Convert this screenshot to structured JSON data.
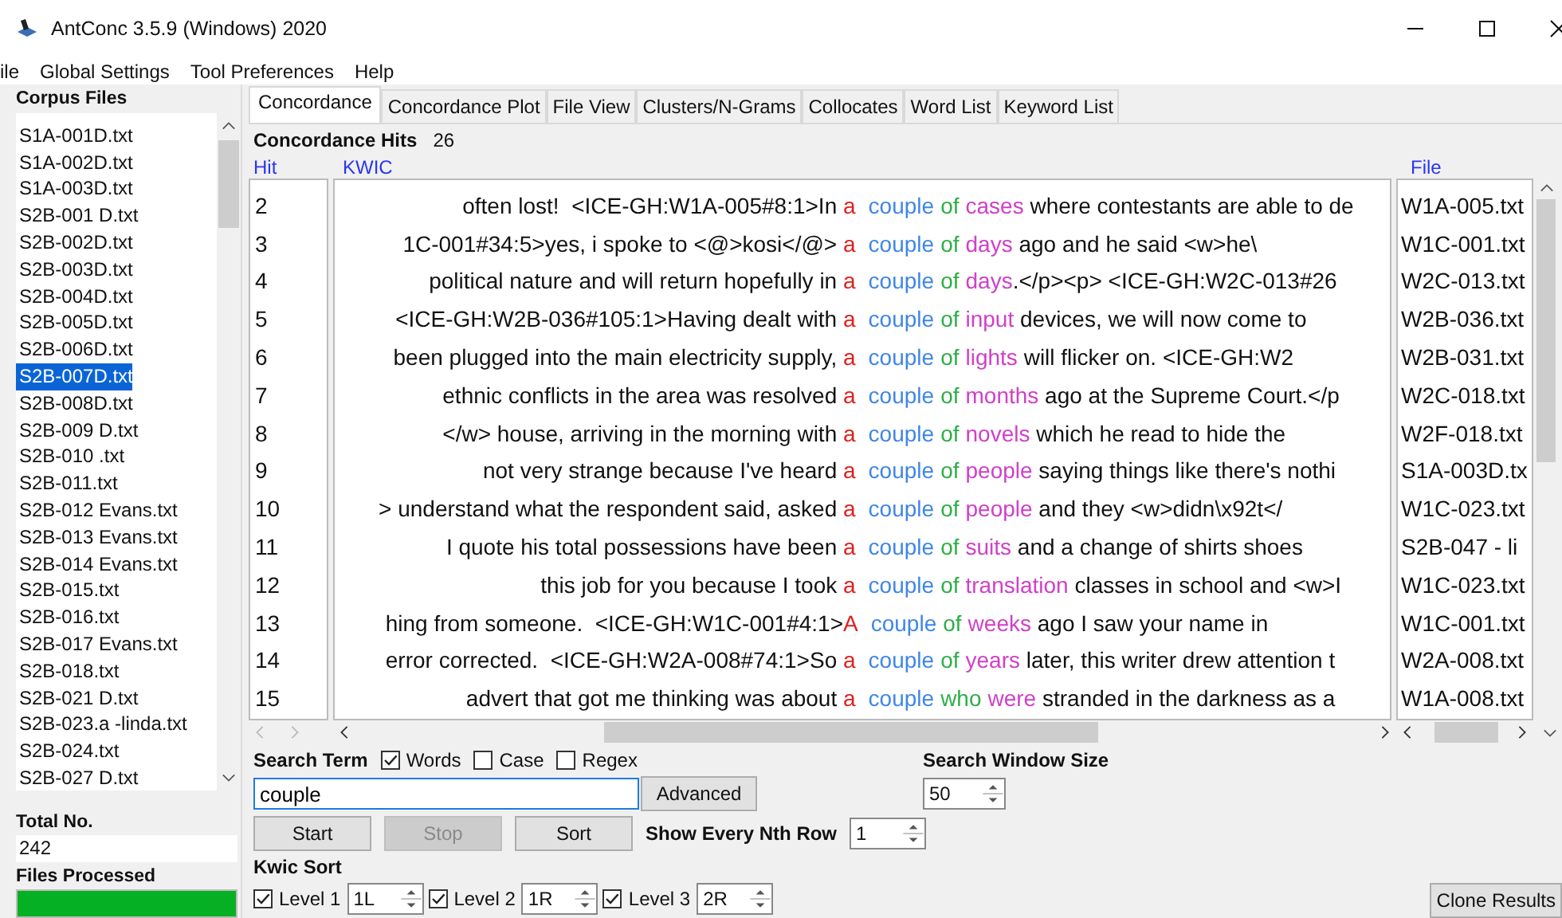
{
  "window": {
    "title": "AntConc 3.5.9 (Windows) 2020"
  },
  "menu": [
    "ile",
    "Global Settings",
    "Tool Preferences",
    "Help"
  ],
  "corpus_files": {
    "heading": "Corpus Files",
    "items": [
      {
        "name": "S1A-001D.txt",
        "selected": false
      },
      {
        "name": "S1A-002D.txt",
        "selected": false
      },
      {
        "name": "S1A-003D.txt",
        "selected": false
      },
      {
        "name": "S2B-001 D.txt",
        "selected": false
      },
      {
        "name": "S2B-002D.txt",
        "selected": false
      },
      {
        "name": "S2B-003D.txt",
        "selected": false
      },
      {
        "name": "S2B-004D.txt",
        "selected": false
      },
      {
        "name": "S2B-005D.txt",
        "selected": false
      },
      {
        "name": "S2B-006D.txt",
        "selected": false
      },
      {
        "name": "S2B-007D.txt",
        "selected": true
      },
      {
        "name": "S2B-008D.txt",
        "selected": false
      },
      {
        "name": "S2B-009 D.txt",
        "selected": false
      },
      {
        "name": "S2B-010 .txt",
        "selected": false
      },
      {
        "name": "S2B-011.txt",
        "selected": false
      },
      {
        "name": "S2B-012 Evans.txt",
        "selected": false
      },
      {
        "name": "S2B-013 Evans.txt",
        "selected": false
      },
      {
        "name": "S2B-014 Evans.txt",
        "selected": false
      },
      {
        "name": "S2B-015.txt",
        "selected": false
      },
      {
        "name": "S2B-016.txt",
        "selected": false
      },
      {
        "name": "S2B-017 Evans.txt",
        "selected": false
      },
      {
        "name": "S2B-018.txt",
        "selected": false
      },
      {
        "name": "S2B-021 D.txt",
        "selected": false
      },
      {
        "name": "S2B-023.a -linda.txt",
        "selected": false
      },
      {
        "name": "S2B-024.txt",
        "selected": false
      },
      {
        "name": "S2B-027 D.txt",
        "selected": false
      }
    ],
    "total_label": "Total No.",
    "total": "242",
    "processed_label": "Files Processed",
    "progress": {
      "level": 1
    }
  },
  "tabs": [
    {
      "label": "Concordance",
      "selected": true
    },
    {
      "label": "Concordance Plot",
      "selected": false
    },
    {
      "label": "File View",
      "selected": false
    },
    {
      "label": "Clusters/N-Grams",
      "selected": false
    },
    {
      "label": "Collocates",
      "selected": false
    },
    {
      "label": "Word List",
      "selected": false
    },
    {
      "label": "Keyword List",
      "selected": false
    }
  ],
  "concordance": {
    "hits_label": "Concordance Hits",
    "hits": "26",
    "columns": {
      "hit": "Hit",
      "kwic": "KWIC",
      "file": "File"
    },
    "rows": [
      {
        "hit": "2",
        "left": "often lost!  <ICE-GH:W1A-005#8:1>In ",
        "keywords": [
          "a",
          "couple",
          "of",
          "cases"
        ],
        "right": " where contestants are able to de",
        "file": "W1A-005.txt"
      },
      {
        "hit": "3",
        "left": "1C-001#34:5>yes, i spoke to <@>kosi</@> ",
        "keywords": [
          "a",
          "couple",
          "of",
          "days"
        ],
        "right": " ago and he said <w>he\\",
        "file": "W1C-001.txt"
      },
      {
        "hit": "4",
        "left": "political nature and will return hopefully in ",
        "keywords": [
          "a",
          "couple",
          "of",
          "days"
        ],
        "right": ".</p><p> <ICE-GH:W2C-013#26",
        "file": "W2C-013.txt"
      },
      {
        "hit": "5",
        "left": "<ICE-GH:W2B-036#105:1>Having dealt with ",
        "keywords": [
          "a",
          "couple",
          "of",
          "input"
        ],
        "right": " devices, we will now come to",
        "file": "W2B-036.txt"
      },
      {
        "hit": "6",
        "left": "been plugged into the main electricity supply, ",
        "keywords": [
          "a",
          "couple",
          "of",
          "lights"
        ],
        "right": " will flicker on. <ICE-GH:W2",
        "file": "W2B-031.txt"
      },
      {
        "hit": "7",
        "left": "ethnic conflicts in the area was resolved ",
        "keywords": [
          "a",
          "couple",
          "of",
          "months"
        ],
        "right": " ago at the Supreme Court.</p",
        "file": "W2C-018.txt"
      },
      {
        "hit": "8",
        "left": "</w> house, arriving in the morning with ",
        "keywords": [
          "a",
          "couple",
          "of",
          "novels"
        ],
        "right": " which he read to hide the",
        "file": "W2F-018.txt"
      },
      {
        "hit": "9",
        "left": "not very strange because I've heard ",
        "keywords": [
          "a",
          "couple",
          "of",
          "people"
        ],
        "right": " saying things like there's nothi",
        "file": "S1A-003D.tx"
      },
      {
        "hit": "10",
        "left": "> understand what the respondent said, asked ",
        "keywords": [
          "a",
          "couple",
          "of",
          "people"
        ],
        "right": " and they <w>didn\\x92t</",
        "file": "W1C-023.txt"
      },
      {
        "hit": "11",
        "left": "I quote his total possessions have been ",
        "keywords": [
          "a",
          "couple",
          "of",
          "suits"
        ],
        "right": " and a change of shirts shoes",
        "file": "S2B-047 - li"
      },
      {
        "hit": "12",
        "left": "this job for you because I took ",
        "keywords": [
          "a",
          "couple",
          "of",
          "translation"
        ],
        "right": " classes in school and <w>I",
        "file": "W1C-023.txt"
      },
      {
        "hit": "13",
        "left": "hing from someone.  <ICE-GH:W1C-001#4:1>",
        "keywords": [
          "A",
          "couple",
          "of",
          "weeks"
        ],
        "right": " ago I saw your name in",
        "file": "W1C-001.txt"
      },
      {
        "hit": "14",
        "left": "error corrected.  <ICE-GH:W2A-008#74:1>So ",
        "keywords": [
          "a",
          "couple",
          "of",
          "years"
        ],
        "right": " later, this writer drew attention t",
        "file": "W2A-008.txt"
      },
      {
        "hit": "15",
        "left": "advert that got me thinking was about ",
        "keywords": [
          "a",
          "couple",
          "who",
          "were"
        ],
        "right": " stranded in the darkness as a",
        "file": "W1A-008.txt"
      }
    ]
  },
  "search": {
    "label": "Search Term",
    "options": [
      {
        "label": "Words",
        "checked": true
      },
      {
        "label": "Case",
        "checked": false
      },
      {
        "label": "Regex",
        "checked": false
      }
    ],
    "value": "couple",
    "advanced": "Advanced",
    "window_size_label": "Search Window Size",
    "window_size": "50",
    "buttons": [
      {
        "label": "Start",
        "disabled": false
      },
      {
        "label": "Stop",
        "disabled": true
      },
      {
        "label": "Sort",
        "disabled": false
      }
    ],
    "nth_row_label": "Show Every Nth Row",
    "nth_row": "1"
  },
  "kwic_sort": {
    "label": "Kwic Sort",
    "levels": [
      {
        "label": "Level 1",
        "checked": true,
        "value": "1L"
      },
      {
        "label": "Level 2",
        "checked": true,
        "value": "1R"
      },
      {
        "label": "Level 3",
        "checked": true,
        "value": "2R"
      }
    ]
  },
  "clone_button": "Clone Results"
}
